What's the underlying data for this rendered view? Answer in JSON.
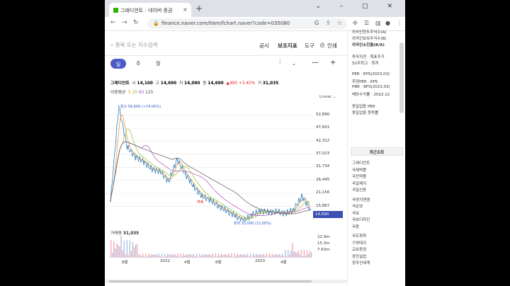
{
  "browser": {
    "tab_title": "그래디언트 : 네이버 증권",
    "tab_close": "×",
    "new_tab": "+",
    "url": "finance.naver.com/item/fchart.naver?code=035080"
  },
  "toolbar": {
    "search_placeholder": "종목 또는 지수검색",
    "menu_notice": "공시",
    "menu_indicators": "보조지표",
    "menu_tools": "도구",
    "menu_print": "인쇄"
  },
  "period": {
    "day": "일",
    "week": "주",
    "month": "월"
  },
  "ohlc": {
    "name": "그래디언트",
    "open_label": "시",
    "open": "14,100",
    "high_label": "고",
    "high": "14,690",
    "low_label": "저",
    "low": "14,090",
    "close_label": "종",
    "close": "14,690",
    "change": "▲490",
    "change_pct": "+3.45%",
    "volume_label": "거",
    "volume": "31,035"
  },
  "ma": {
    "label": "이동평균",
    "p5": "5",
    "p20": "20",
    "p60": "60",
    "p120": "120"
  },
  "colors": {
    "accent": "#4a5cc8",
    "price_line": "#2d7fc1",
    "ma5": "#ef8a23",
    "ma20": "#8ec13a",
    "ma60": "#b24fbf",
    "ma120": "#555555",
    "up": "#e0242d",
    "down": "#2a58c4"
  },
  "chart": {
    "scale": "Linear",
    "current_price": "14,690",
    "high_annotation": "최고 56,600 (+74.00%)",
    "low_annotation": "최저 10,000 (12.00%)",
    "cross_annotation": "역배",
    "volume_label": "거래량",
    "volume_value": "31,035"
  },
  "chart_data": {
    "type": "line",
    "y_ticks": [
      "52,890",
      "47,601",
      "42,312",
      "37,023",
      "31,734",
      "26,445",
      "21,156",
      "15,867"
    ],
    "ylim": [
      10000,
      56600
    ],
    "x_ticks": [
      "8월",
      "2022",
      "4월",
      "8월",
      "2023",
      "4월"
    ],
    "volume_ticks": [
      "22.9m",
      "15.3m",
      "7.63m"
    ],
    "x": [
      "2021-07",
      "2021-08",
      "2021-09",
      "2021-10",
      "2021-11",
      "2021-12",
      "2022-01",
      "2022-02",
      "2022-03",
      "2022-04",
      "2022-05",
      "2022-06",
      "2022-07",
      "2022-08",
      "2022-09",
      "2022-10",
      "2022-11",
      "2022-12",
      "2023-01",
      "2023-02",
      "2023-03",
      "2023-04",
      "2023-05",
      "2023-06",
      "2023-07"
    ],
    "series": [
      {
        "values": [
          18000,
          56600,
          40000,
          36000,
          34000,
          31000,
          30000,
          26000,
          35000,
          29000,
          24000,
          20000,
          18500,
          16000,
          14000,
          12000,
          10000,
          12500,
          14000,
          13500,
          13800,
          13000,
          14500,
          20000,
          14690
        ]
      }
    ]
  },
  "sidebar": {
    "items_top": [
      "외국인한도주식수(A)",
      "외국인보유주식수(B)",
      "외국인소진율(B/A)"
    ],
    "items_mid": [
      "투자의견 · 목표주가",
      "52주최고 · 최저"
    ],
    "items_val": [
      "PER · EPS(2023.03)",
      "추정PER · EPS",
      "PBR · BPS(2023.03)",
      "배당수익률 · 2022.12"
    ],
    "items_sector": [
      "동일업종 PER",
      "동일업종 등락률"
    ],
    "recent_title": "최근조회",
    "recent": [
      "그래디언트",
      "국제약품",
      "국전약품",
      "국일제지",
      "국일신동",
      "국영지앤엠",
      "국순당",
      "국보",
      "국보디자인",
      "국동",
      "국도화학",
      "구영테크",
      "교보증권",
      "광진실업",
      "광주신세계"
    ]
  }
}
